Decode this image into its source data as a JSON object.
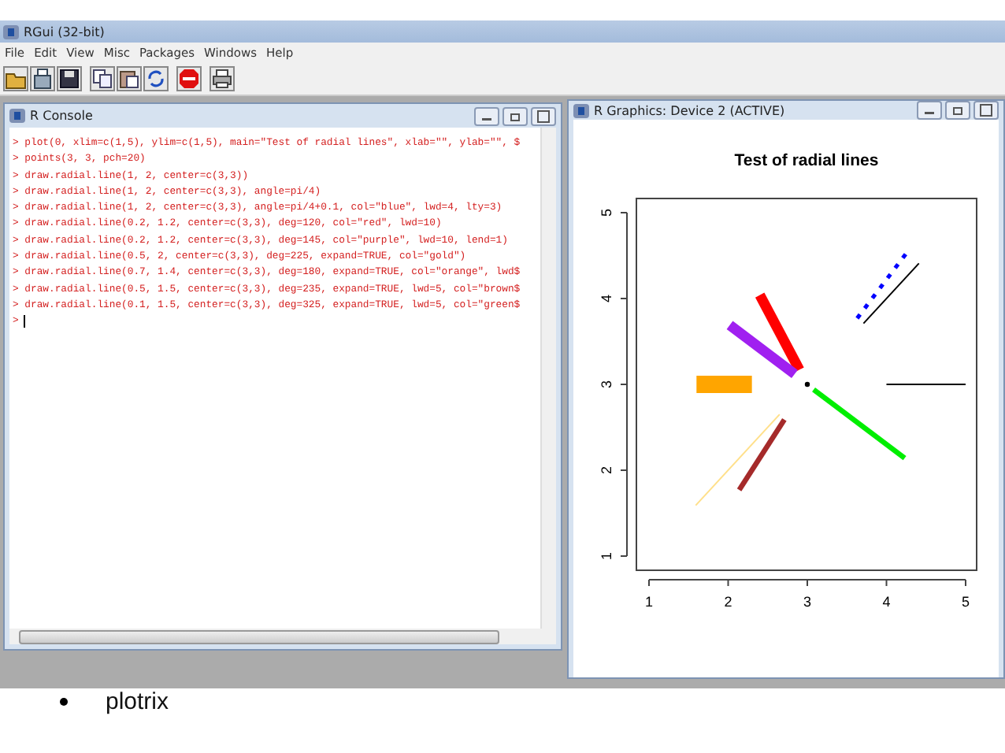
{
  "app": {
    "title": "RGui (32-bit)",
    "menu": [
      "File",
      "Edit",
      "View",
      "Misc",
      "Packages",
      "Windows",
      "Help"
    ],
    "toolbar": [
      {
        "kind": "open"
      },
      {
        "kind": "load"
      },
      {
        "kind": "save"
      },
      {
        "kind": "copy"
      },
      {
        "kind": "paste"
      },
      {
        "kind": "copypaste"
      },
      {
        "kind": "stop"
      },
      {
        "kind": "print"
      }
    ]
  },
  "console": {
    "title": "R Console",
    "lines": [
      "> plot(0, xlim=c(1,5), ylim=c(1,5), main=\"Test of radial lines\", xlab=\"\", ylab=\"\", $",
      "> points(3, 3, pch=20)",
      "> draw.radial.line(1, 2, center=c(3,3))",
      "> draw.radial.line(1, 2, center=c(3,3), angle=pi/4)",
      "> draw.radial.line(1, 2, center=c(3,3), angle=pi/4+0.1, col=\"blue\", lwd=4, lty=3)",
      "> draw.radial.line(0.2, 1.2, center=c(3,3), deg=120, col=\"red\", lwd=10)",
      "> draw.radial.line(0.2, 1.2, center=c(3,3), deg=145, col=\"purple\", lwd=10, lend=1)",
      "> draw.radial.line(0.5, 2, center=c(3,3), deg=225, expand=TRUE, col=\"gold\")",
      "> draw.radial.line(0.7, 1.4, center=c(3,3), deg=180, expand=TRUE, col=\"orange\", lwd$",
      "> draw.radial.line(0.5, 1.5, center=c(3,3), deg=235, expand=TRUE, lwd=5, col=\"brown$",
      "> draw.radial.line(0.1, 1.5, center=c(3,3), deg=325, expand=TRUE, lwd=5, col=\"green$",
      ">"
    ]
  },
  "graphics": {
    "title": "R Graphics: Device 2 (ACTIVE)",
    "chart_data": {
      "type": "line",
      "title": "Test of radial lines",
      "xlim": [
        1,
        5
      ],
      "ylim": [
        1,
        5
      ],
      "xticks": [
        1,
        2,
        3,
        4,
        5
      ],
      "yticks": [
        1,
        2,
        3,
        4,
        5
      ],
      "series": [
        {
          "color": "#000000",
          "marker": "dot",
          "line_style": "none",
          "x": [
            3
          ],
          "values": [
            3
          ]
        },
        {
          "color": "#000000",
          "line_style": "solid",
          "x": [
            4,
            5
          ],
          "values": [
            3,
            3
          ]
        },
        {
          "color": "#000000",
          "line_style": "solid",
          "x": [
            3.71,
            4.41
          ],
          "values": [
            3.71,
            4.41
          ]
        },
        {
          "color": "#0000ff",
          "line_style": "dotted",
          "x": [
            3.63,
            4.27
          ],
          "values": [
            3.77,
            4.55
          ]
        },
        {
          "color": "#ff0000",
          "line_style": "solid",
          "x": [
            2.9,
            2.4
          ],
          "values": [
            3.17,
            4.04
          ]
        },
        {
          "color": "#a020f0",
          "line_style": "solid",
          "x": [
            2.84,
            2.02
          ],
          "values": [
            3.12,
            3.69
          ]
        },
        {
          "color": "#ffe08a",
          "line_style": "solid",
          "x": [
            2.65,
            1.59
          ],
          "values": [
            2.65,
            1.59
          ]
        },
        {
          "color": "#ffa500",
          "line_style": "solid",
          "x": [
            2.3,
            1.6
          ],
          "values": [
            3,
            3
          ]
        },
        {
          "color": "#a52a2a",
          "line_style": "solid",
          "x": [
            2.71,
            2.14
          ],
          "values": [
            2.59,
            1.77
          ]
        },
        {
          "color": "#00ee00",
          "line_style": "solid",
          "x": [
            3.08,
            4.23
          ],
          "values": [
            2.94,
            2.14
          ]
        }
      ]
    }
  },
  "slide": {
    "bullets": [
      "plotrix"
    ]
  }
}
